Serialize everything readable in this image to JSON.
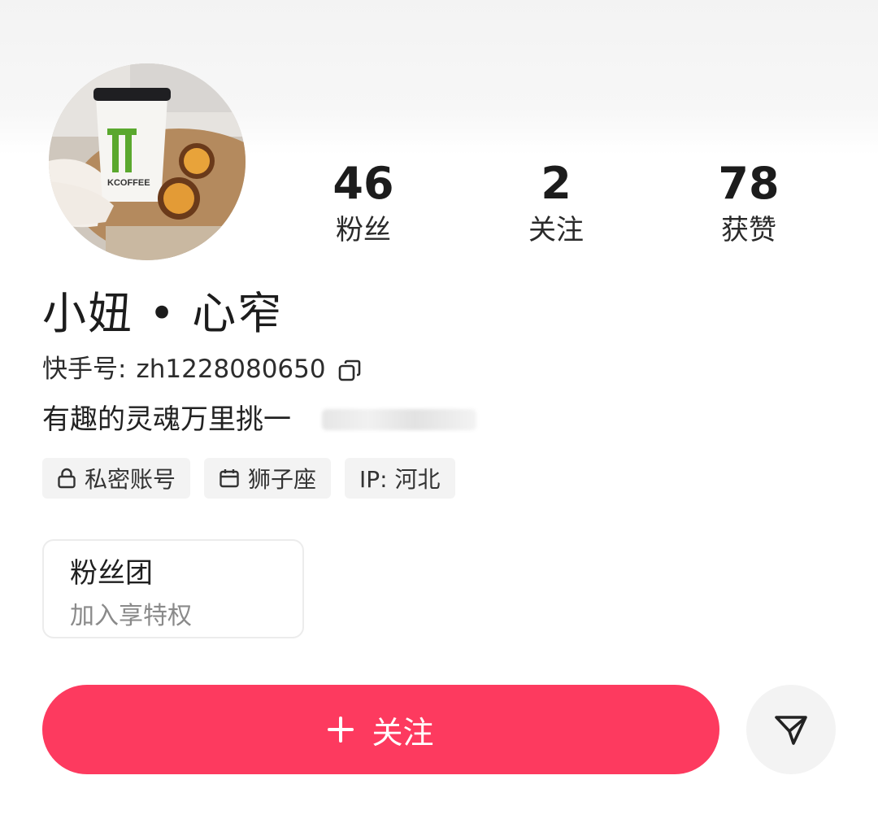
{
  "profile": {
    "name": "小妞 • 心窄",
    "id_label": "快手号:",
    "id_value": "zh1228080650",
    "bio": "有趣的灵魂万里挑一"
  },
  "stats": [
    {
      "value": "46",
      "label": "粉丝"
    },
    {
      "value": "2",
      "label": "关注"
    },
    {
      "value": "78",
      "label": "获赞"
    }
  ],
  "tags": [
    {
      "icon": "lock-icon",
      "label": "私密账号"
    },
    {
      "icon": "calendar-icon",
      "label": "狮子座"
    },
    {
      "icon": "",
      "label": "IP: 河北"
    }
  ],
  "fan_club": {
    "title": "粉丝团",
    "subtitle": "加入享特权"
  },
  "actions": {
    "follow_label": "关注",
    "share_icon": "send-icon"
  },
  "colors": {
    "accent": "#fd3a5f",
    "tag_bg": "#f3f3f3",
    "muted_text": "#8a8a8a"
  }
}
